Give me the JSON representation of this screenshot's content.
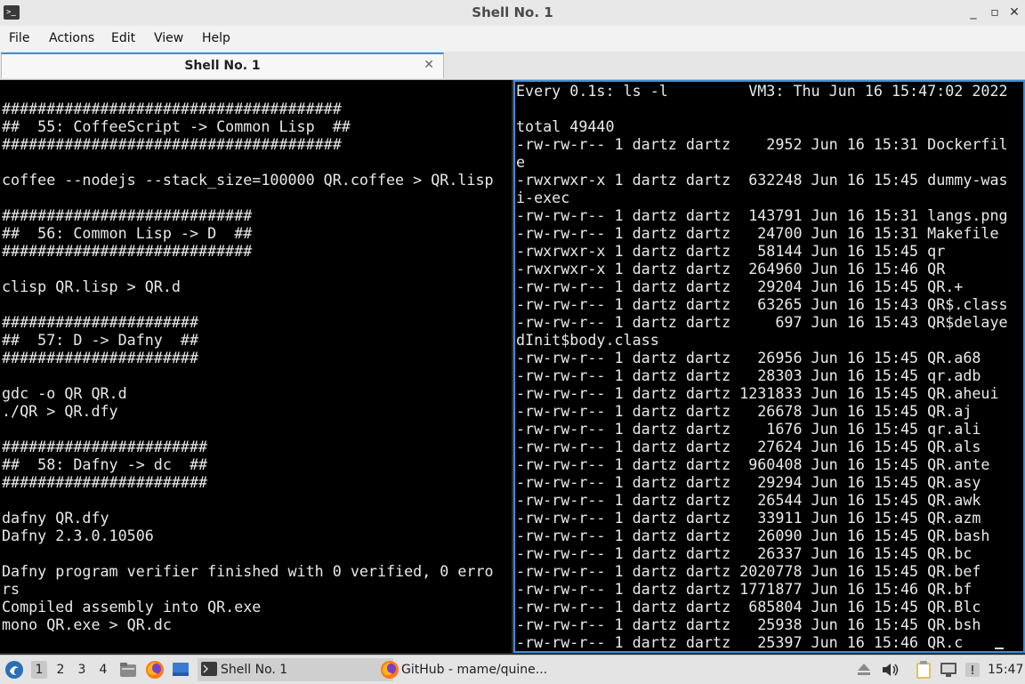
{
  "window": {
    "title": "Shell No. 1"
  },
  "menu": {
    "items": [
      "File",
      "Actions",
      "Edit",
      "View",
      "Help"
    ]
  },
  "tabs": [
    {
      "label": "Shell No. 1"
    }
  ],
  "left_terminal": {
    "lines": [
      "",
      "######################################",
      "##  55: CoffeeScript -> Common Lisp  ##",
      "######################################",
      "",
      "coffee --nodejs --stack_size=100000 QR.coffee > QR.lisp",
      "",
      "############################",
      "##  56: Common Lisp -> D  ##",
      "############################",
      "",
      "clisp QR.lisp > QR.d",
      "",
      "######################",
      "##  57: D -> Dafny  ##",
      "######################",
      "",
      "gdc -o QR QR.d",
      "./QR > QR.dfy",
      "",
      "#######################",
      "##  58: Dafny -> dc  ##",
      "#######################",
      "",
      "dafny QR.dfy",
      "Dafny 2.3.0.10506",
      "",
      "Dafny program verifier finished with 0 verified, 0 erro",
      "rs",
      "Compiled assembly into QR.exe",
      "mono QR.exe > QR.dc",
      ""
    ]
  },
  "right_terminal": {
    "lines": [
      "Every 0.1s: ls -l         VM3: Thu Jun 16 15:47:02 2022",
      "",
      "total 49440",
      "-rw-rw-r-- 1 dartz dartz    2952 Jun 16 15:31 Dockerfil",
      "e",
      "-rwxrwxr-x 1 dartz dartz  632248 Jun 16 15:45 dummy-was",
      "i-exec",
      "-rw-rw-r-- 1 dartz dartz  143791 Jun 16 15:31 langs.png",
      "-rw-rw-r-- 1 dartz dartz   24700 Jun 16 15:31 Makefile",
      "-rwxrwxr-x 1 dartz dartz   58144 Jun 16 15:45 qr",
      "-rwxrwxr-x 1 dartz dartz  264960 Jun 16 15:46 QR",
      "-rw-rw-r-- 1 dartz dartz   29204 Jun 16 15:45 QR.+",
      "-rw-rw-r-- 1 dartz dartz   63265 Jun 16 15:43 QR$.class",
      "-rw-rw-r-- 1 dartz dartz     697 Jun 16 15:43 QR$delaye",
      "dInit$body.class",
      "-rw-rw-r-- 1 dartz dartz   26956 Jun 16 15:45 QR.a68",
      "-rw-rw-r-- 1 dartz dartz   28303 Jun 16 15:45 qr.adb",
      "-rw-rw-r-- 1 dartz dartz 1231833 Jun 16 15:45 QR.aheui",
      "-rw-rw-r-- 1 dartz dartz   26678 Jun 16 15:45 QR.aj",
      "-rw-rw-r-- 1 dartz dartz    1676 Jun 16 15:45 qr.ali",
      "-rw-rw-r-- 1 dartz dartz   27624 Jun 16 15:45 QR.als",
      "-rw-rw-r-- 1 dartz dartz  960408 Jun 16 15:45 QR.ante",
      "-rw-rw-r-- 1 dartz dartz   29294 Jun 16 15:45 QR.asy",
      "-rw-rw-r-- 1 dartz dartz   26544 Jun 16 15:45 QR.awk",
      "-rw-rw-r-- 1 dartz dartz   33911 Jun 16 15:45 QR.azm",
      "-rw-rw-r-- 1 dartz dartz   26090 Jun 16 15:45 QR.bash",
      "-rw-rw-r-- 1 dartz dartz   26337 Jun 16 15:45 QR.bc",
      "-rw-rw-r-- 1 dartz dartz 2020778 Jun 16 15:45 QR.bef",
      "-rw-rw-r-- 1 dartz dartz 1771877 Jun 16 15:46 QR.bf",
      "-rw-rw-r-- 1 dartz dartz  685804 Jun 16 15:45 QR.Blc",
      "-rw-rw-r-- 1 dartz dartz   25938 Jun 16 15:45 QR.bsh",
      "-rw-rw-r-- 1 dartz dartz   25397 Jun 16 15:46 QR.c"
    ]
  },
  "taskbar": {
    "workspaces": [
      "1",
      "2",
      "3",
      "4"
    ],
    "active_workspace": "1",
    "quicklaunch_icons": [
      "start-menu-icon",
      "file-manager-icon",
      "firefox-icon",
      "show-desktop-icon"
    ],
    "tasks": [
      {
        "label": "Shell No. 1",
        "icon": "terminal-icon",
        "active": true
      },
      {
        "label": "GitHub - mame/quine...",
        "icon": "firefox-icon",
        "active": false
      }
    ],
    "tray_icons": [
      "eject-icon",
      "volume-icon",
      "clipboard-icon",
      "network-icon",
      "notification-icon"
    ],
    "clock": "15:47"
  },
  "colors": {
    "accent": "#3b8ed8",
    "terminal_bg": "#000000",
    "terminal_fg": "#e9e9e9"
  }
}
